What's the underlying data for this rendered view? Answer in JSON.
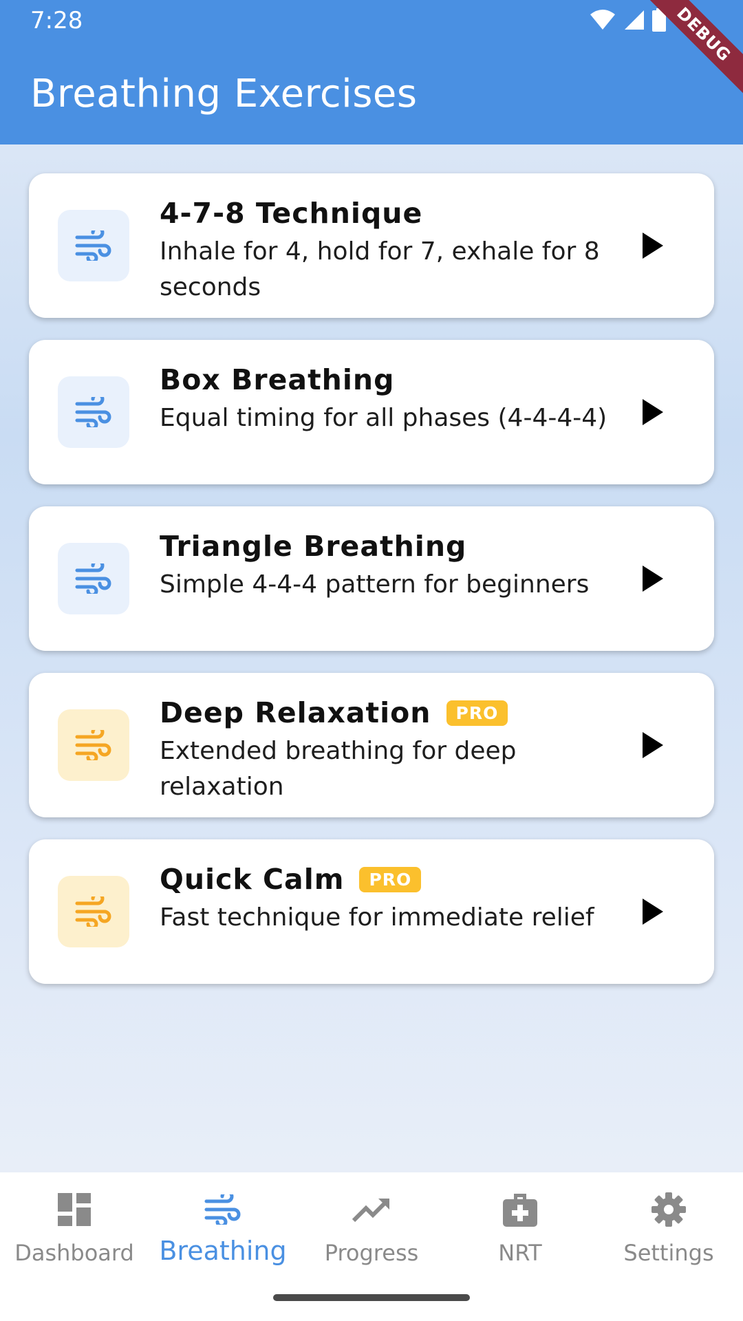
{
  "status_bar": {
    "time": "7:28"
  },
  "debug_banner": "DEBUG",
  "app_bar": {
    "title": "Breathing Exercises"
  },
  "colors": {
    "primary": "#4a90e2",
    "pro_accent": "#fbc02d",
    "pro_icon": "#f5a623"
  },
  "exercises": [
    {
      "title": "4-7-8 Technique",
      "description": "Inhale for 4, hold for 7, exhale for 8 seconds",
      "pro": false,
      "icon": "air-icon"
    },
    {
      "title": "Box Breathing",
      "description": "Equal timing for all phases (4-4-4-4)",
      "pro": false,
      "icon": "air-icon"
    },
    {
      "title": "Triangle Breathing",
      "description": "Simple 4-4-4 pattern for beginners",
      "pro": false,
      "icon": "air-icon"
    },
    {
      "title": "Deep Relaxation",
      "description": "Extended breathing for deep relaxation",
      "pro": true,
      "badge": "PRO",
      "icon": "air-icon"
    },
    {
      "title": "Quick Calm",
      "description": "Fast technique for immediate relief",
      "pro": true,
      "badge": "PRO",
      "icon": "air-icon"
    }
  ],
  "bottom_nav": {
    "active": "Breathing",
    "items": [
      {
        "label": "Dashboard",
        "icon": "dashboard-icon"
      },
      {
        "label": "Breathing",
        "icon": "air-icon"
      },
      {
        "label": "Progress",
        "icon": "trending-up-icon"
      },
      {
        "label": "NRT",
        "icon": "medical-kit-icon"
      },
      {
        "label": "Settings",
        "icon": "gear-icon"
      }
    ]
  }
}
